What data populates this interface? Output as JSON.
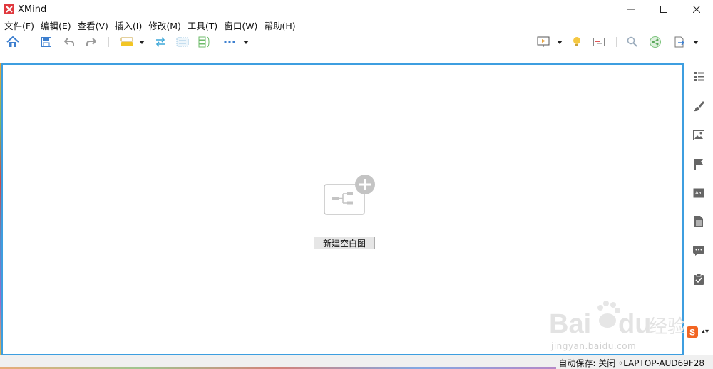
{
  "window": {
    "title": "XMind",
    "controls": [
      "minimize-icon",
      "maximize-icon",
      "close-icon"
    ]
  },
  "menu": [
    {
      "label": "文件(F)"
    },
    {
      "label": "编辑(E)"
    },
    {
      "label": "查看(V)"
    },
    {
      "label": "插入(I)"
    },
    {
      "label": "修改(M)"
    },
    {
      "label": "工具(T)"
    },
    {
      "label": "窗口(W)"
    },
    {
      "label": "帮助(H)"
    }
  ],
  "toolbar": {
    "left_icons": [
      "home-icon",
      "save-icon",
      "undo-icon",
      "redo-icon",
      "topic-style-icon",
      "relationship-icon",
      "boundary-icon",
      "summary-icon",
      "more-icon"
    ],
    "right_icons": [
      "presentation-icon",
      "idea-icon",
      "gantt-icon",
      "search-icon",
      "share-icon",
      "export-icon"
    ]
  },
  "canvas": {
    "new_blank_label": "新建空白图"
  },
  "sidebar_icons": [
    "outline-icon",
    "format-brush-icon",
    "image-icon",
    "marker-flag-icon",
    "text-style-icon",
    "notes-icon",
    "comment-icon",
    "task-icon"
  ],
  "watermark": {
    "brand": "Bai du 经验",
    "url": "jingyan.baidu.com"
  },
  "status": {
    "text": "自动保存: 关闭 ◦LAPTOP-AUD69F28"
  },
  "ime": {
    "badge": "S"
  },
  "colors": {
    "accent_border": "#3d9ee0",
    "logo_red": "#e0393e",
    "save_blue": "#3d7fcf",
    "status_bg": "#f0f0f0",
    "ime_orange": "#f26522"
  }
}
